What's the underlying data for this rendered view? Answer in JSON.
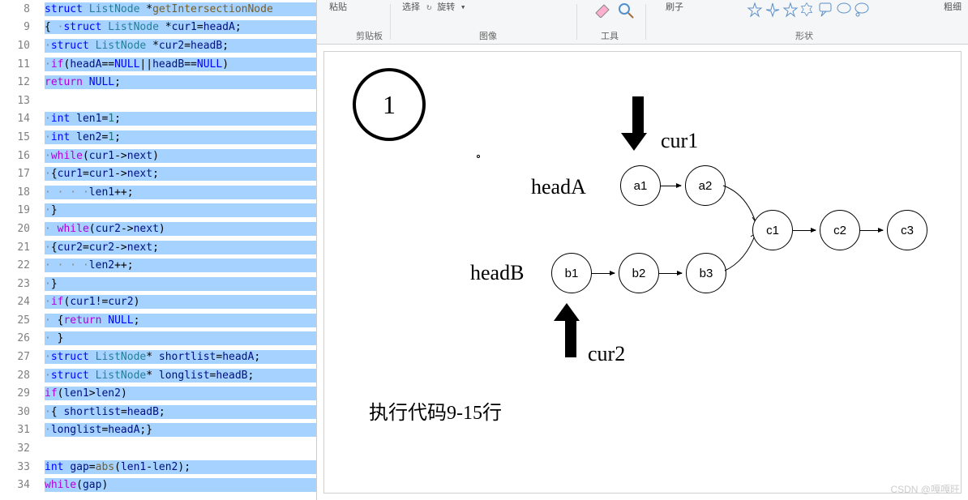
{
  "code": {
    "lines": [
      {
        "num": "8",
        "tokens": [
          {
            "t": "struct",
            "c": "kw-struct"
          },
          {
            "t": " "
          },
          {
            "t": "ListNode",
            "c": "kw-type"
          },
          {
            "t": " *"
          },
          {
            "t": "getIntersectionNode",
            "c": "kw-func"
          }
        ]
      },
      {
        "num": "9",
        "tokens": [
          {
            "t": "{ ",
            "c": ""
          },
          {
            "t": "·",
            "c": "kw-dot"
          },
          {
            "t": "struct",
            "c": "kw-struct"
          },
          {
            "t": " "
          },
          {
            "t": "ListNode",
            "c": "kw-type"
          },
          {
            "t": " *"
          },
          {
            "t": "cur1",
            "c": "kw-var"
          },
          {
            "t": "="
          },
          {
            "t": "headA",
            "c": "kw-var"
          },
          {
            "t": ";"
          }
        ]
      },
      {
        "num": "10",
        "tokens": [
          {
            "t": "·",
            "c": "kw-dot"
          },
          {
            "t": "struct",
            "c": "kw-struct"
          },
          {
            "t": " "
          },
          {
            "t": "ListNode",
            "c": "kw-type"
          },
          {
            "t": " *"
          },
          {
            "t": "cur2",
            "c": "kw-var"
          },
          {
            "t": "="
          },
          {
            "t": "headB",
            "c": "kw-var"
          },
          {
            "t": ";"
          }
        ]
      },
      {
        "num": "11",
        "tokens": [
          {
            "t": "·",
            "c": "kw-dot"
          },
          {
            "t": "if",
            "c": "kw-keyword"
          },
          {
            "t": "("
          },
          {
            "t": "headA",
            "c": "kw-var"
          },
          {
            "t": "=="
          },
          {
            "t": "NULL",
            "c": "kw-null"
          },
          {
            "t": "||"
          },
          {
            "t": "headB",
            "c": "kw-var"
          },
          {
            "t": "=="
          },
          {
            "t": "NULL",
            "c": "kw-null"
          },
          {
            "t": ")"
          }
        ]
      },
      {
        "num": "12",
        "tokens": [
          {
            "t": "return",
            "c": "kw-return"
          },
          {
            "t": " "
          },
          {
            "t": "NULL",
            "c": "kw-null"
          },
          {
            "t": ";"
          }
        ]
      },
      {
        "num": "13",
        "tokens": [],
        "empty": true
      },
      {
        "num": "14",
        "tokens": [
          {
            "t": "·",
            "c": "kw-dot"
          },
          {
            "t": "int",
            "c": "kw-int"
          },
          {
            "t": " "
          },
          {
            "t": "len1",
            "c": "kw-var"
          },
          {
            "t": "="
          },
          {
            "t": "1",
            "c": "kw-num"
          },
          {
            "t": ";"
          }
        ]
      },
      {
        "num": "15",
        "tokens": [
          {
            "t": "·",
            "c": "kw-dot"
          },
          {
            "t": "int",
            "c": "kw-int"
          },
          {
            "t": " "
          },
          {
            "t": "len2",
            "c": "kw-var"
          },
          {
            "t": "="
          },
          {
            "t": "1",
            "c": "kw-num"
          },
          {
            "t": ";"
          }
        ]
      },
      {
        "num": "16",
        "tokens": [
          {
            "t": "·",
            "c": "kw-dot"
          },
          {
            "t": "while",
            "c": "kw-keyword"
          },
          {
            "t": "("
          },
          {
            "t": "cur1",
            "c": "kw-var"
          },
          {
            "t": "->"
          },
          {
            "t": "next",
            "c": "kw-var"
          },
          {
            "t": ")"
          }
        ]
      },
      {
        "num": "17",
        "tokens": [
          {
            "t": "·",
            "c": "kw-dot"
          },
          {
            "t": "{"
          },
          {
            "t": "cur1",
            "c": "kw-var"
          },
          {
            "t": "="
          },
          {
            "t": "cur1",
            "c": "kw-var"
          },
          {
            "t": "->"
          },
          {
            "t": "next",
            "c": "kw-var"
          },
          {
            "t": ";"
          }
        ]
      },
      {
        "num": "18",
        "tokens": [
          {
            "t": "· · · ·",
            "c": "kw-dot"
          },
          {
            "t": "len1",
            "c": "kw-var"
          },
          {
            "t": "++;"
          }
        ]
      },
      {
        "num": "19",
        "tokens": [
          {
            "t": "·",
            "c": "kw-dot"
          },
          {
            "t": "}"
          }
        ]
      },
      {
        "num": "20",
        "tokens": [
          {
            "t": "· ",
            "c": "kw-dot"
          },
          {
            "t": "while",
            "c": "kw-keyword"
          },
          {
            "t": "("
          },
          {
            "t": "cur2",
            "c": "kw-var"
          },
          {
            "t": "->"
          },
          {
            "t": "next",
            "c": "kw-var"
          },
          {
            "t": ")"
          }
        ]
      },
      {
        "num": "21",
        "tokens": [
          {
            "t": "·",
            "c": "kw-dot"
          },
          {
            "t": "{"
          },
          {
            "t": "cur2",
            "c": "kw-var"
          },
          {
            "t": "="
          },
          {
            "t": "cur2",
            "c": "kw-var"
          },
          {
            "t": "->"
          },
          {
            "t": "next",
            "c": "kw-var"
          },
          {
            "t": ";"
          }
        ]
      },
      {
        "num": "22",
        "tokens": [
          {
            "t": "· · · ·",
            "c": "kw-dot"
          },
          {
            "t": "len2",
            "c": "kw-var"
          },
          {
            "t": "++;"
          }
        ]
      },
      {
        "num": "23",
        "tokens": [
          {
            "t": "·",
            "c": "kw-dot"
          },
          {
            "t": "}"
          }
        ]
      },
      {
        "num": "24",
        "tokens": [
          {
            "t": "·",
            "c": "kw-dot"
          },
          {
            "t": "if",
            "c": "kw-keyword"
          },
          {
            "t": "("
          },
          {
            "t": "cur1",
            "c": "kw-var"
          },
          {
            "t": "!="
          },
          {
            "t": "cur2",
            "c": "kw-var"
          },
          {
            "t": ")"
          }
        ]
      },
      {
        "num": "25",
        "tokens": [
          {
            "t": "· ",
            "c": "kw-dot"
          },
          {
            "t": "{"
          },
          {
            "t": "return",
            "c": "kw-return"
          },
          {
            "t": " "
          },
          {
            "t": "NULL",
            "c": "kw-null"
          },
          {
            "t": ";"
          }
        ]
      },
      {
        "num": "26",
        "tokens": [
          {
            "t": "· ",
            "c": "kw-dot"
          },
          {
            "t": "}"
          }
        ]
      },
      {
        "num": "27",
        "tokens": [
          {
            "t": "·",
            "c": "kw-dot"
          },
          {
            "t": "struct",
            "c": "kw-struct"
          },
          {
            "t": " "
          },
          {
            "t": "ListNode",
            "c": "kw-type"
          },
          {
            "t": "* "
          },
          {
            "t": "shortlist",
            "c": "kw-var"
          },
          {
            "t": "="
          },
          {
            "t": "headA",
            "c": "kw-var"
          },
          {
            "t": ";"
          }
        ]
      },
      {
        "num": "28",
        "tokens": [
          {
            "t": "·",
            "c": "kw-dot"
          },
          {
            "t": "struct",
            "c": "kw-struct"
          },
          {
            "t": " "
          },
          {
            "t": "ListNode",
            "c": "kw-type"
          },
          {
            "t": "* "
          },
          {
            "t": "longlist",
            "c": "kw-var"
          },
          {
            "t": "="
          },
          {
            "t": "headB",
            "c": "kw-var"
          },
          {
            "t": ";"
          }
        ]
      },
      {
        "num": "29",
        "tokens": [
          {
            "t": "if",
            "c": "kw-keyword"
          },
          {
            "t": "("
          },
          {
            "t": "len1",
            "c": "kw-var"
          },
          {
            "t": ">"
          },
          {
            "t": "len2",
            "c": "kw-var"
          },
          {
            "t": ")"
          }
        ]
      },
      {
        "num": "30",
        "tokens": [
          {
            "t": "·",
            "c": "kw-dot"
          },
          {
            "t": "{ "
          },
          {
            "t": "shortlist",
            "c": "kw-var"
          },
          {
            "t": "="
          },
          {
            "t": "headB",
            "c": "kw-var"
          },
          {
            "t": ";"
          }
        ]
      },
      {
        "num": "31",
        "tokens": [
          {
            "t": "·",
            "c": "kw-dot"
          },
          {
            "t": "longlist",
            "c": "kw-var"
          },
          {
            "t": "="
          },
          {
            "t": "headA",
            "c": "kw-var"
          },
          {
            "t": ";}"
          }
        ]
      },
      {
        "num": "32",
        "tokens": [],
        "empty": true
      },
      {
        "num": "33",
        "tokens": [
          {
            "t": "int",
            "c": "kw-int"
          },
          {
            "t": " "
          },
          {
            "t": "gap",
            "c": "kw-var"
          },
          {
            "t": "="
          },
          {
            "t": "abs",
            "c": "kw-func"
          },
          {
            "t": "("
          },
          {
            "t": "len1",
            "c": "kw-var"
          },
          {
            "t": "-"
          },
          {
            "t": "len2",
            "c": "kw-var"
          },
          {
            "t": ");"
          }
        ]
      },
      {
        "num": "34",
        "tokens": [
          {
            "t": "while",
            "c": "kw-keyword"
          },
          {
            "t": "("
          },
          {
            "t": "gap",
            "c": "kw-var"
          },
          {
            "t": ")"
          }
        ]
      }
    ]
  },
  "ribbon": {
    "paste_label": "粘贴",
    "select_label": "选择",
    "rotate_label": "旋转",
    "brush_label": "刷子",
    "thin_label": "粗细",
    "clipboard": "剪贴板",
    "image": "图像",
    "tool": "工具",
    "shape": "形状"
  },
  "diagram": {
    "step": "1",
    "cur1": "cur1",
    "cur2": "cur2",
    "headA": "headA",
    "headB": "headB",
    "nodes": {
      "a1": "a1",
      "a2": "a2",
      "b1": "b1",
      "b2": "b2",
      "b3": "b3",
      "c1": "c1",
      "c2": "c2",
      "c3": "c3"
    },
    "exec_text": "执行代码9-15行"
  },
  "watermark": "CSDN @嘎嘎旺"
}
